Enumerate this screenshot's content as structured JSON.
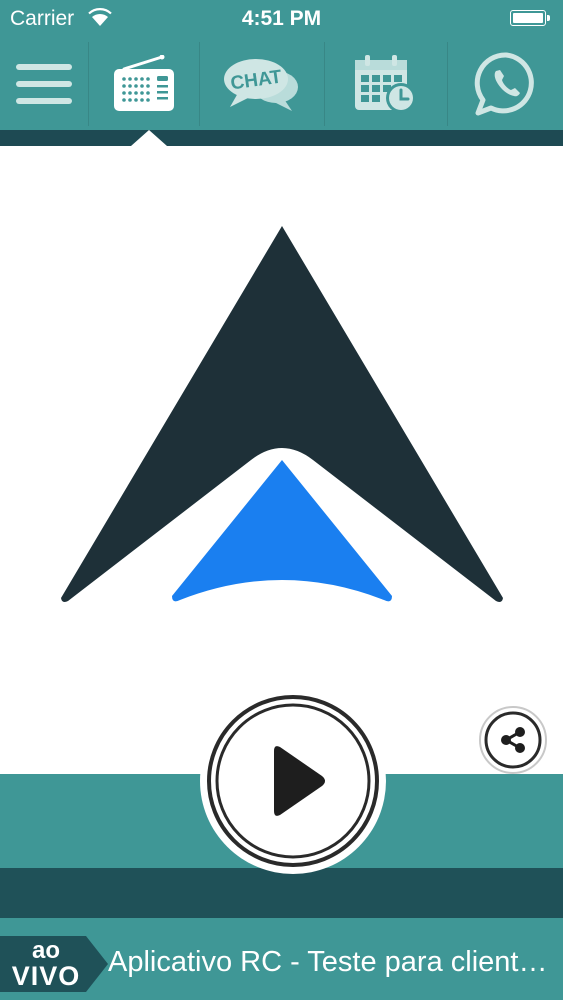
{
  "status_bar": {
    "carrier": "Carrier",
    "time": "4:51 PM",
    "wifi_icon": "wifi-icon",
    "battery_icon": "battery-icon"
  },
  "nav": {
    "items": [
      {
        "icon": "menu-icon",
        "active": false
      },
      {
        "icon": "radio-icon",
        "active": true
      },
      {
        "icon": "chat-icon",
        "label": "CHAT",
        "active": false
      },
      {
        "icon": "calendar-icon",
        "active": false
      },
      {
        "icon": "whatsapp-icon",
        "active": false
      }
    ]
  },
  "player": {
    "logo": "station-logo-icon",
    "play_icon": "play-icon",
    "share_icon": "share-icon"
  },
  "footer": {
    "badge_line1": "ao",
    "badge_line2": "VIVO",
    "now_playing": "Aplicativo RC - Teste para clientes"
  },
  "colors": {
    "teal": "#3f9796",
    "dark_teal": "#1e4a53",
    "logo_dark": "#1e3038",
    "logo_blue": "#1a7ff0",
    "white": "#ffffff"
  }
}
